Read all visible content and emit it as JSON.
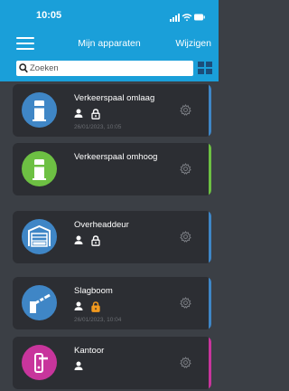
{
  "status_bar": {
    "time": "10:05"
  },
  "header": {
    "title": "Mijn apparaten",
    "edit_label": "Wijzigen"
  },
  "search": {
    "placeholder": "Zoeken"
  },
  "colors": {
    "header": "#1a9fd9",
    "background": "#3b3f45",
    "card": "#2c2e33"
  },
  "devices": [
    {
      "name": "Verkeerspaal omlaag",
      "timestamp": "26/01/2023, 10:05",
      "icon": "bollard-down-icon",
      "icon_color": "#3f86c6",
      "bar_color": "#3f86c6",
      "user": true,
      "lock": "white"
    },
    {
      "name": "Verkeerspaal omhoog",
      "timestamp": "",
      "icon": "bollard-up-icon",
      "icon_color": "#6dc043",
      "bar_color": "#6dc043",
      "user": false,
      "lock": ""
    },
    {
      "name": "Overheaddeur",
      "timestamp": "",
      "icon": "garage-door-icon",
      "icon_color": "#3f86c6",
      "bar_color": "#3f86c6",
      "user": true,
      "lock": "white"
    },
    {
      "name": "Slagboom",
      "timestamp": "26/01/2023, 10:04",
      "icon": "barrier-gate-icon",
      "icon_color": "#3f86c6",
      "bar_color": "#3f86c6",
      "user": true,
      "lock": "orange"
    },
    {
      "name": "Kantoor",
      "timestamp": "",
      "icon": "door-handle-icon",
      "icon_color": "#c8359c",
      "bar_color": "#c8359c",
      "user": true,
      "lock": ""
    }
  ]
}
